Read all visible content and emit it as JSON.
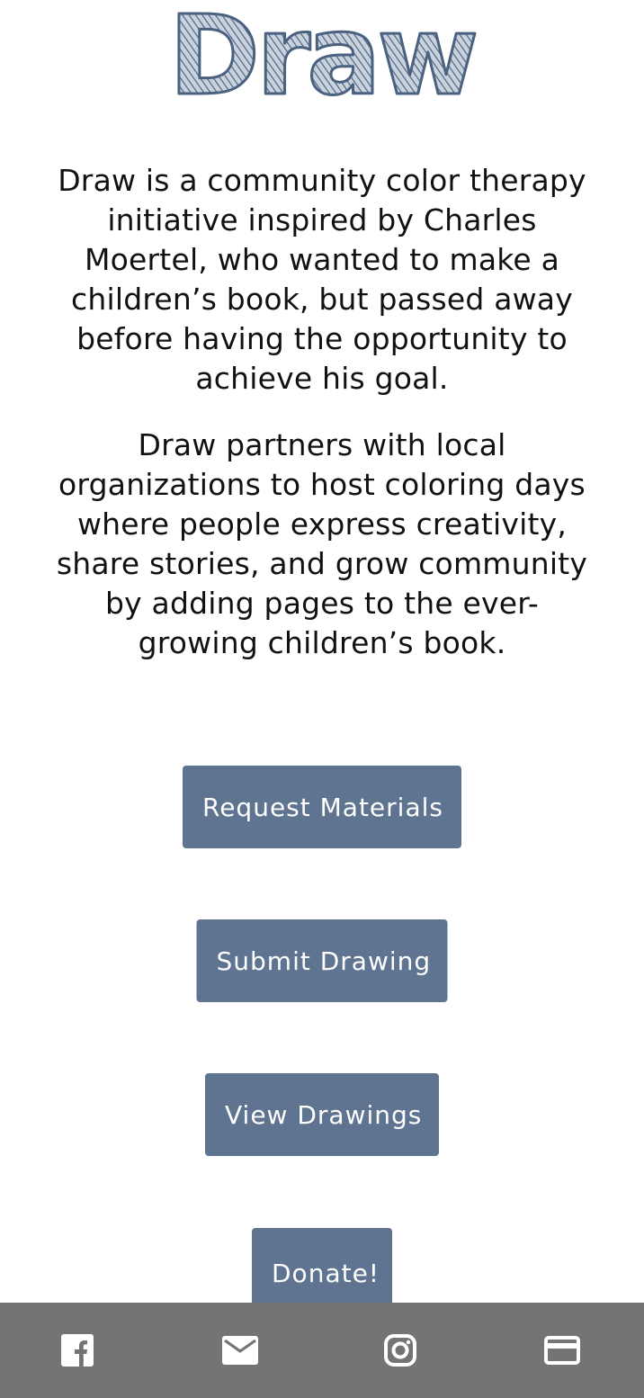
{
  "header": {
    "logo_text": "Draw"
  },
  "about": {
    "paragraph1": "Draw is a community color therapy initiative inspired by Charles Moertel, who wanted to make a children’s book, but passed away before having the opportunity to achieve his goal.",
    "paragraph2": "Draw partners with local organizations to host coloring days where people express creativity, share stories, and grow community by adding pages to the ever-growing children’s book."
  },
  "actions": {
    "request_materials": "Request Materials",
    "submit_drawing": "Submit Drawing",
    "view_drawings": "View Drawings",
    "donate": "Donate!"
  },
  "footer": {
    "icons": [
      "facebook-icon",
      "mail-icon",
      "instagram-icon",
      "credit-card-icon"
    ]
  },
  "colors": {
    "accent": "#5e7490",
    "footer_bg": "#747474",
    "logo_fill": "#5c728e"
  }
}
